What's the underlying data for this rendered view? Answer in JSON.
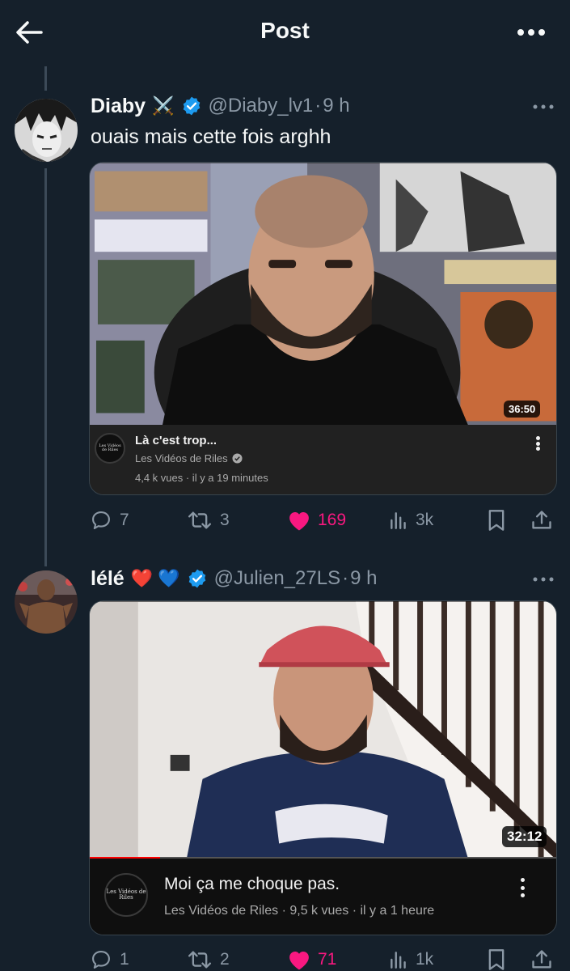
{
  "header": {
    "title": "Post"
  },
  "posts": [
    {
      "name": "Diaby",
      "emoji": "⚔️",
      "handle": "@Diaby_lv1",
      "dot": "·",
      "time": "9 h",
      "text": "ouais mais cette fois arghh",
      "video": {
        "duration": "36:50",
        "title": "Là c'est trop...",
        "channel": "Les Vidéos de Riles",
        "stats": "4,4 k vues · il y a 19 minutes",
        "channel_logo": "Les Vidéos de Riles"
      },
      "actions": {
        "replies": "7",
        "reposts": "3",
        "likes": "169",
        "views": "3k"
      }
    },
    {
      "name": "lélé",
      "emoji": "❤️ 💙",
      "handle": "@Julien_27LS",
      "dot": "·",
      "time": "9 h",
      "text": "",
      "video": {
        "duration": "32:12",
        "title": "Moi ça me choque pas.",
        "channel_stats": "Les Vidéos de Riles · 9,5 k vues · il y a 1 heure",
        "channel_logo": "Les Vidéos de Riles",
        "progress": 0.15
      },
      "actions": {
        "replies": "1",
        "reposts": "2",
        "likes": "71",
        "views": "1k"
      }
    }
  ],
  "colors": {
    "background": "#15202b",
    "verified": "#1d9bf0",
    "like": "#f91880",
    "muted": "#8b98a5",
    "youtube_progress": "#ff0000"
  }
}
